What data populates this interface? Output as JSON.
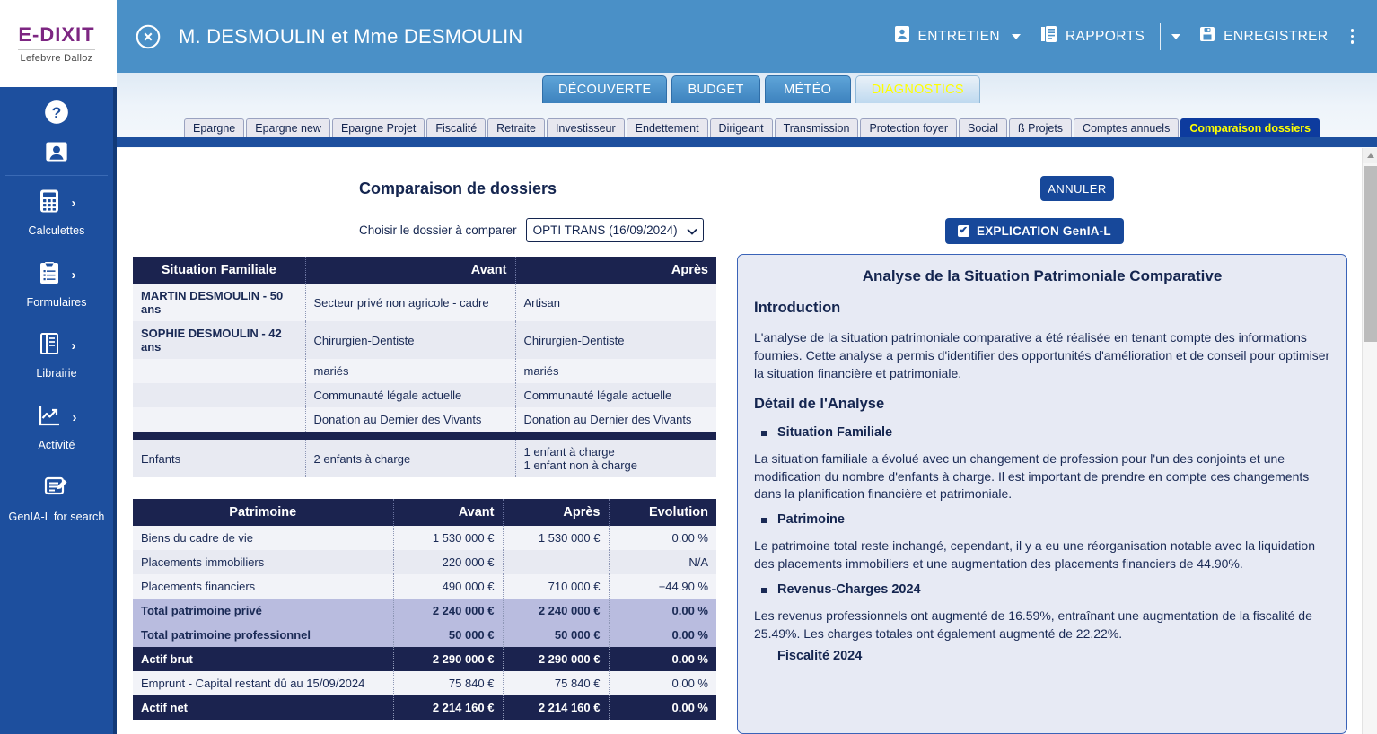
{
  "brand": {
    "name": "E-DIXIT",
    "tagline": "Lefebvre Dalloz"
  },
  "sidebar": {
    "top_icons": [
      {
        "name": "help-icon",
        "glyph": "?"
      },
      {
        "name": "user-icon",
        "glyph": "■"
      }
    ],
    "items": [
      {
        "label": "Calculettes",
        "icon": "calculator-icon",
        "chevron": "›"
      },
      {
        "label": "Formulaires",
        "icon": "clipboard-icon",
        "chevron": "›"
      },
      {
        "label": "Librairie",
        "icon": "book-icon",
        "chevron": "›"
      },
      {
        "label": "Activité",
        "icon": "chart-line-icon",
        "chevron": "›"
      },
      {
        "label": "GenIA-L for search",
        "icon": "document-edit-icon",
        "chevron": ""
      }
    ]
  },
  "header": {
    "close_label": "×",
    "client_title": "M. DESMOULIN et Mme DESMOULIN",
    "actions": [
      {
        "label": "ENTRETIEN",
        "icon": "id-card-icon",
        "has_caret": true
      },
      {
        "label": "RAPPORTS",
        "icon": "report-icon",
        "has_caret": false
      },
      {
        "label": "ENREGISTRER",
        "icon": "save-icon",
        "has_caret": false
      }
    ],
    "kebab": "more-options"
  },
  "tabs": {
    "main": [
      {
        "label": "DÉCOUVERTE",
        "active": false
      },
      {
        "label": "BUDGET",
        "active": false
      },
      {
        "label": "MÉTÉO",
        "active": false
      },
      {
        "label": "DIAGNOSTICS",
        "active": true
      }
    ],
    "sub": [
      {
        "label": "Epargne",
        "active": false
      },
      {
        "label": "Epargne new",
        "active": false
      },
      {
        "label": "Epargne Projet",
        "active": false
      },
      {
        "label": "Fiscalité",
        "active": false
      },
      {
        "label": "Retraite",
        "active": false
      },
      {
        "label": "Investisseur",
        "active": false
      },
      {
        "label": "Endettement",
        "active": false
      },
      {
        "label": "Dirigeant",
        "active": false
      },
      {
        "label": "Transmission",
        "active": false
      },
      {
        "label": "Protection foyer",
        "active": false
      },
      {
        "label": "Social",
        "active": false
      },
      {
        "label": "ß Projets",
        "active": false
      },
      {
        "label": "Comptes annuels",
        "active": false
      },
      {
        "label": "Comparaison dossiers",
        "active": true
      }
    ]
  },
  "main": {
    "page_title": "Comparaison de dossiers",
    "chooser_label": "Choisir le dossier à comparer",
    "chooser_value": "OPTI TRANS (16/09/2024)",
    "chooser_caret": "⌄",
    "cancel_button": "ANNULER",
    "explication_button": "EXPLICATION GenIA-L",
    "explication_checked": true,
    "check_glyph": "✔"
  },
  "table_situation": {
    "headers": [
      "Situation Familiale",
      "Avant",
      "Après"
    ],
    "rows": [
      {
        "name": "MARTIN DESMOULIN - 50 ans",
        "bold": true,
        "avant": "Secteur privé non agricole - cadre",
        "apres": "Artisan"
      },
      {
        "name": "SOPHIE DESMOULIN - 42 ans",
        "bold": true,
        "avant": "Chirurgien-Dentiste",
        "apres": "Chirurgien-Dentiste"
      },
      {
        "name": "",
        "bold": false,
        "avant": "mariés",
        "apres": "mariés"
      },
      {
        "name": "",
        "bold": false,
        "avant": "Communauté légale actuelle",
        "apres": "Communauté légale actuelle"
      },
      {
        "name": "",
        "bold": false,
        "avant": "Donation au Dernier des Vivants",
        "apres": "Donation au Dernier des Vivants"
      },
      {
        "separator": true
      },
      {
        "name": "Enfants",
        "bold": false,
        "avant": "2 enfants à charge",
        "apres": "1 enfant à charge\n1 enfant non à charge"
      }
    ]
  },
  "table_patrimoine": {
    "headers": [
      "Patrimoine",
      "Avant",
      "Après",
      "Evolution"
    ],
    "rows": [
      {
        "label": "Biens du cadre de vie",
        "avant": "1 530 000 €",
        "apres": "1 530 000 €",
        "evolution": "0.00 %",
        "style": "normal"
      },
      {
        "label": "Placements immobiliers",
        "avant": "220 000 €",
        "apres": "",
        "evolution": "N/A",
        "style": "normal"
      },
      {
        "label": "Placements financiers",
        "avant": "490 000 €",
        "apres": "710 000 €",
        "evolution": "+44.90 %",
        "style": "normal"
      },
      {
        "label": "Total patrimoine privé",
        "avant": "2 240 000 €",
        "apres": "2 240 000 €",
        "evolution": "0.00 %",
        "style": "subtotal"
      },
      {
        "label": "Total patrimoine professionnel",
        "avant": "50 000 €",
        "apres": "50 000 €",
        "evolution": "0.00 %",
        "style": "subtotal"
      },
      {
        "label": "Actif brut",
        "avant": "2 290 000 €",
        "apres": "2 290 000 €",
        "evolution": "0.00 %",
        "style": "total"
      },
      {
        "label": "Emprunt - Capital restant dû au 15/09/2024",
        "avant": "75 840 €",
        "apres": "75 840 €",
        "evolution": "0.00 %",
        "style": "normal"
      },
      {
        "label": "Actif net",
        "avant": "2 214 160 €",
        "apres": "2 214 160 €",
        "evolution": "0.00 %",
        "style": "total"
      }
    ]
  },
  "panel": {
    "title": "Analyse de la Situation Patrimoniale Comparative",
    "intro_heading": "Introduction",
    "intro_text": "L'analyse de la situation patrimoniale comparative a été réalisée en tenant compte des informations fournies. Cette analyse a permis d'identifier des opportunités d'amélioration et de conseil pour optimiser la situation financière et patrimoniale.",
    "detail_heading": "Détail de l'Analyse",
    "sections": [
      {
        "bullet": "Situation Familiale",
        "text": "La situation familiale a évolué avec un changement de profession pour l'un des conjoints et une modification du nombre d'enfants à charge. Il est important de prendre en compte ces changements dans la planification financière et patrimoniale."
      },
      {
        "bullet": "Patrimoine",
        "text": "Le patrimoine total reste inchangé, cependant, il y a eu une réorganisation notable avec la liquidation des placements immobiliers et une augmentation des placements financiers de 44.90%."
      },
      {
        "bullet": "Revenus-Charges 2024",
        "text": "Les revenus professionnels ont augmenté de 16.59%, entraînant une augmentation de la fiscalité de 25.49%. Les charges totales ont également augmenté de 22.22%."
      }
    ],
    "clipped_heading": "Fiscalité 2024"
  },
  "colors": {
    "brand_purple": "#7d2682",
    "sidebar_blue": "#1d4f9e",
    "header_blue": "#4a90c7",
    "table_header_navy": "#1b234f",
    "accent_yellow": "#ffff00",
    "button_blue": "#17489a"
  }
}
